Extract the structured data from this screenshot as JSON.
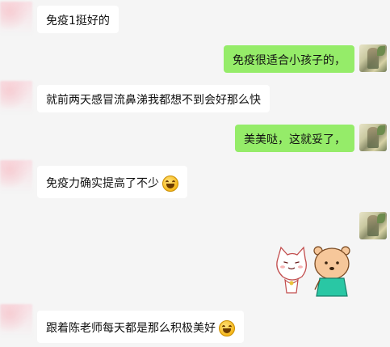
{
  "messages": [
    {
      "side": "left",
      "text": "免疫1挺好的"
    },
    {
      "side": "right",
      "text": "免疫很适合小孩子的，"
    },
    {
      "side": "left",
      "text": "就前两天感冒流鼻涕我都想不到会好那么快"
    },
    {
      "side": "right",
      "text": "美美哒，这就妥了，"
    },
    {
      "side": "left",
      "text": "免疫力确实提高了不少",
      "emoji": "grinning-emoji"
    },
    {
      "side": "right",
      "sticker": "cat-and-bear-sticker"
    },
    {
      "side": "left",
      "text": "跟着陈老师每天都是那么积极美好",
      "emoji": "grinning-emoji"
    }
  ],
  "colors": {
    "background": "#f5f5f5",
    "left_bubble": "#ffffff",
    "right_bubble": "#95ec69"
  }
}
